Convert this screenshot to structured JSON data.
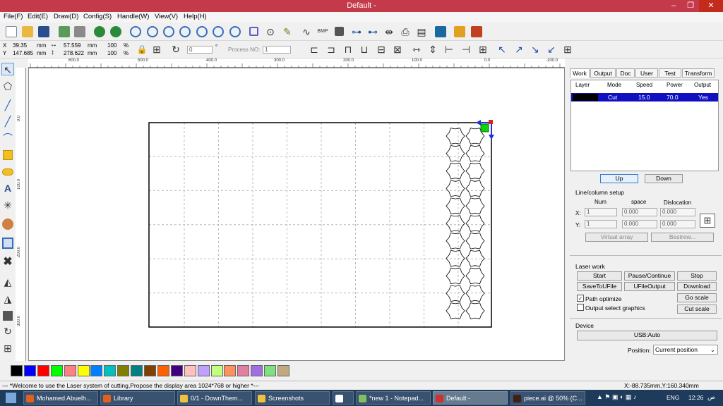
{
  "window": {
    "title": "Default -",
    "minimize": "–",
    "maximize": "❐",
    "close": "✕",
    "accent": "#c43a4a"
  },
  "menu": [
    "File(F)",
    "Edit(E)",
    "Draw(D)",
    "Config(S)",
    "Handle(W)",
    "View(V)",
    "Help(H)"
  ],
  "coords": {
    "x_label": "X",
    "x_value": "39.35",
    "x_unit": "mm",
    "y_label": "Y",
    "y_value": "147.685",
    "y_unit": "mm",
    "w_value": "57.559",
    "w_unit": "mm",
    "h_value": "278.622",
    "h_unit": "mm",
    "sx": "100",
    "sx_unit": "%",
    "sy": "100",
    "sy_unit": "%",
    "angle": "0",
    "angle_unit": "°",
    "process_label": "Process NO:",
    "process_value": "1"
  },
  "ruler": {
    "top": [
      "600.0",
      "500.0",
      "400.0",
      "300.0",
      "200.0",
      "100.0",
      "0.0",
      "-100.0"
    ],
    "left": [
      "0.0",
      "100.0",
      "200.0",
      "300.0"
    ]
  },
  "panel": {
    "tabs": [
      "Work",
      "Output",
      "Doc",
      "User",
      "Test",
      "Transform"
    ],
    "layers_headers": [
      "Layer",
      "Mode",
      "Speed",
      "Power",
      "Output"
    ],
    "layer_row": {
      "color": "#000000",
      "mode": "Cut",
      "speed": "15.0",
      "power": "70.0",
      "output": "Yes"
    },
    "up": "Up",
    "down": "Down",
    "line_column": {
      "title": "Line/column setup",
      "num": "Num",
      "space": "space",
      "dislocation": "Dislocation",
      "x_label": "X:",
      "x_num": "1",
      "x_space": "0.000",
      "x_disloc": "0.000",
      "y_label": "Y:",
      "y_num": "1",
      "y_space": "0.000",
      "y_disloc": "0.000",
      "virtual_array": "Virtual array",
      "bestrew": "Bestrew..."
    },
    "laser_work": {
      "title": "Laser work",
      "start": "Start",
      "pause": "Pause/Continue",
      "stop": "Stop",
      "save_to_file": "SaveToUFile",
      "u_file_output": "UFileOutput",
      "download": "Download",
      "path_optimize": "Path optimize",
      "path_optimize_checked": true,
      "output_select": "Output select graphics",
      "output_select_checked": false,
      "go_scale": "Go scale",
      "cut_scale": "Cut scale"
    },
    "device": {
      "title": "Device",
      "usb": "USB:Auto",
      "position_label": "Position:",
      "position_value": "Current position"
    }
  },
  "palette": [
    "#000000",
    "#0000ff",
    "#ff0000",
    "#00ff00",
    "#ff8080",
    "#ffff00",
    "#0080ff",
    "#00c0c0",
    "#808000",
    "#008080",
    "#804000",
    "#ff6000",
    "#400080",
    "#ffc0c0",
    "#c0a0ff",
    "#c0ff80",
    "#ff9060",
    "#e080a0",
    "#a070e0",
    "#80e080",
    "#c0a880"
  ],
  "status": {
    "message": "--- *Welcome to use the Laser system of cutting,Propose the display area 1024*768 or higher *---",
    "position": "X:-88.735mm,Y:160.340mm"
  },
  "taskbar": {
    "tasks": [
      {
        "label": "Mohamed Abuelh...",
        "color": "#e06020"
      },
      {
        "label": "Library",
        "color": "#e06020"
      },
      {
        "label": "0/1 - DownThem...",
        "color": "#f0c040"
      },
      {
        "label": "Screenshots",
        "color": "#f0c040"
      },
      {
        "label": "",
        "color": "#ffffff"
      },
      {
        "label": "*new 1 - Notepad...",
        "color": "#80c060"
      },
      {
        "label": "Default -",
        "color": "#d03030"
      },
      {
        "label": "piece.ai @ 50% (C...",
        "color": "#402010"
      }
    ],
    "language": "ENG",
    "clock": "12:26",
    "clock_suffix": "ص"
  }
}
